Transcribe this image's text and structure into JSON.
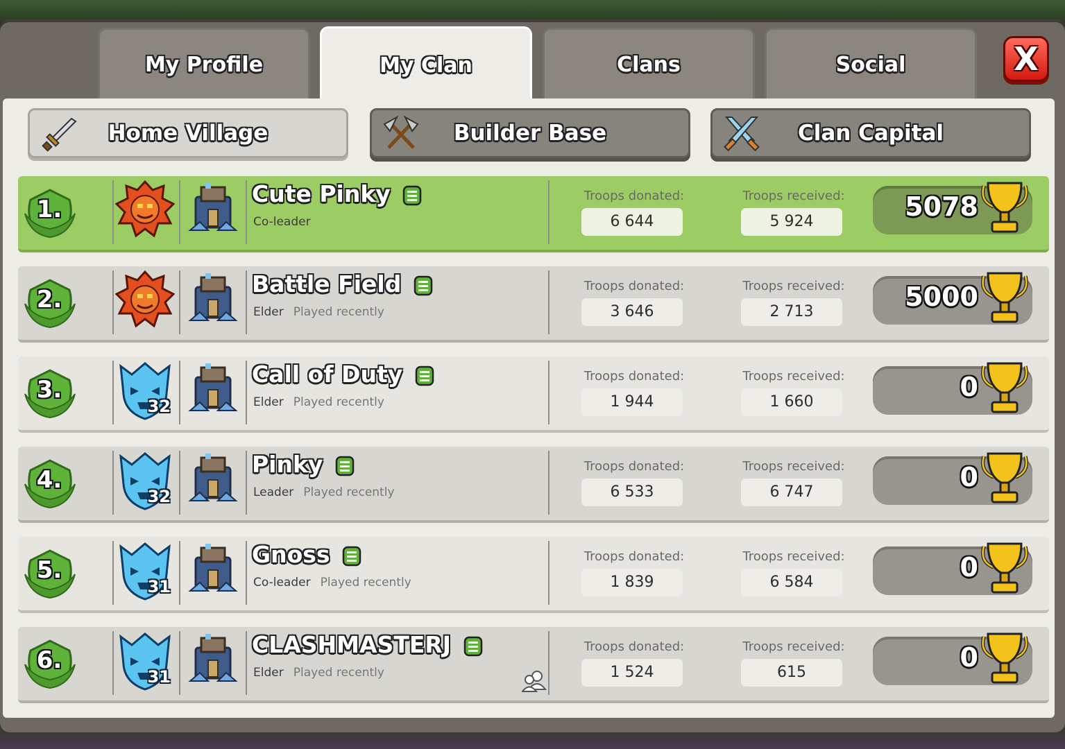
{
  "tabs": [
    {
      "label": "My Profile",
      "active": false
    },
    {
      "label": "My Clan",
      "active": true
    },
    {
      "label": "Clans",
      "active": false
    },
    {
      "label": "Social",
      "active": false
    }
  ],
  "close_label": "X",
  "subtabs": [
    {
      "label": "Home Village",
      "icon": "sword-icon",
      "active": true
    },
    {
      "label": "Builder Base",
      "icon": "crossed-axes-icon",
      "active": false
    },
    {
      "label": "Clan Capital",
      "icon": "crossed-swords-icon",
      "active": false
    }
  ],
  "stat_labels": {
    "donated": "Troops donated:",
    "received": "Troops received:"
  },
  "members": [
    {
      "rank": "1.",
      "name": "Cute Pinky",
      "role": "Co-leader",
      "status": "",
      "league": "legend",
      "league_level": "",
      "donated": "6 644",
      "received": "5 924",
      "trophies": "5078",
      "highlight": true
    },
    {
      "rank": "2.",
      "name": "Battle Field",
      "role": "Elder",
      "status": "Played recently",
      "league": "legend",
      "league_level": "",
      "donated": "3 646",
      "received": "2 713",
      "trophies": "5000",
      "highlight": false
    },
    {
      "rank": "3.",
      "name": "Call of Duty",
      "role": "Elder",
      "status": "Played recently",
      "league": "crystal",
      "league_level": "32",
      "donated": "1 944",
      "received": "1 660",
      "trophies": "0",
      "highlight": false
    },
    {
      "rank": "4.",
      "name": "Pinky",
      "role": "Leader",
      "status": "Played recently",
      "league": "crystal",
      "league_level": "32",
      "donated": "6 533",
      "received": "6 747",
      "trophies": "0",
      "highlight": false
    },
    {
      "rank": "5.",
      "name": "Gnoss",
      "role": "Co-leader",
      "status": "Played recently",
      "league": "crystal",
      "league_level": "31",
      "donated": "1 839",
      "received": "6 584",
      "trophies": "0",
      "highlight": false
    },
    {
      "rank": "6.",
      "name": "CLASHMASTERJ",
      "role": "Elder",
      "status": "Played recently",
      "league": "crystal",
      "league_level": "31",
      "donated": "1 524",
      "received": "615",
      "trophies": "0",
      "highlight": false
    }
  ],
  "colors": {
    "highlight_row": "#9ccc64",
    "close_red": "#d5190f",
    "trophy_gold": "#f3c21b"
  }
}
